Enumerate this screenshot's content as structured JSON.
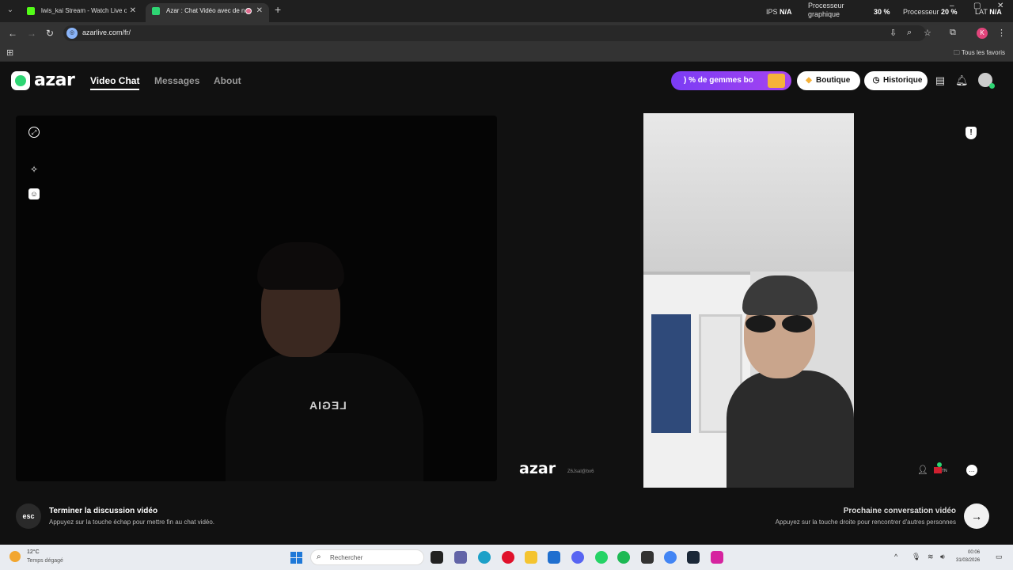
{
  "browser": {
    "tabs": [
      {
        "title": "lwis_kai Stream - Watch Live on",
        "close": "✕",
        "favicon_color": "#53fc18"
      },
      {
        "title": "Azar : Chat Vidéo avec de n",
        "close": "✕",
        "favicon_color": "#2ed573"
      }
    ],
    "new_tab": "+",
    "url": "azarlive.com/fr/",
    "bookmarks_label": "Tous les favoris",
    "profile_initial": "K"
  },
  "overlay_stats": {
    "ips_label": "IPS",
    "ips_value": "N/A",
    "gpu_label": "Processeur graphique",
    "gpu_value": "30 %",
    "cpu_label": "Processeur",
    "cpu_value": "20 %",
    "lat_label": "LAT",
    "lat_value": "N/A"
  },
  "azar": {
    "logo_text": "azar",
    "nav": [
      "Video Chat",
      "Messages",
      "About"
    ],
    "promo_text": ") % de gemmes bo",
    "shop_label": "Boutique",
    "history_label": "Historique",
    "watermark": "azar",
    "watermark_id": "Z6Jsal@bx6",
    "country_code": "TN",
    "end_chat": {
      "key": "esc",
      "title": "Terminer la discussion vidéo",
      "subtitle": "Appuyez sur la touche échap pour mettre fin au chat vidéo."
    },
    "next_chat": {
      "title": "Prochaine conversation vidéo",
      "subtitle": "Appuyez sur la touche droite pour rencontrer d'autres personnes",
      "arrow": "→"
    },
    "shirt_text": "LEGIA"
  },
  "taskbar": {
    "temperature": "12°C",
    "weather": "Temps dégagé",
    "search_placeholder": "Rechercher",
    "time": "00:06",
    "date": "31/03/2026"
  }
}
